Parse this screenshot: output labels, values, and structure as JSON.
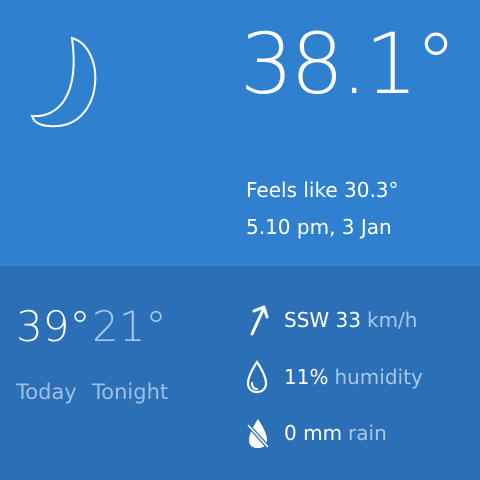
{
  "current": {
    "temperature": "38.1°",
    "feels_like": "Feels like 30.3°",
    "datetime": "5.10 pm, 3 Jan",
    "condition_icon": "moon-icon"
  },
  "forecast": {
    "high": "39°",
    "low": "21°",
    "high_label": "Today",
    "low_label": "Tonight"
  },
  "details": {
    "wind_dir_speed": "SSW 33",
    "wind_unit": "km/h",
    "humidity_value": "11%",
    "humidity_label": "humidity",
    "rain_value": "0 mm",
    "rain_label": "rain"
  },
  "colors": {
    "top_bg": "#2f81cf",
    "bottom_bg": "#2b6fb6",
    "muted_text": "#a9c7ea"
  }
}
